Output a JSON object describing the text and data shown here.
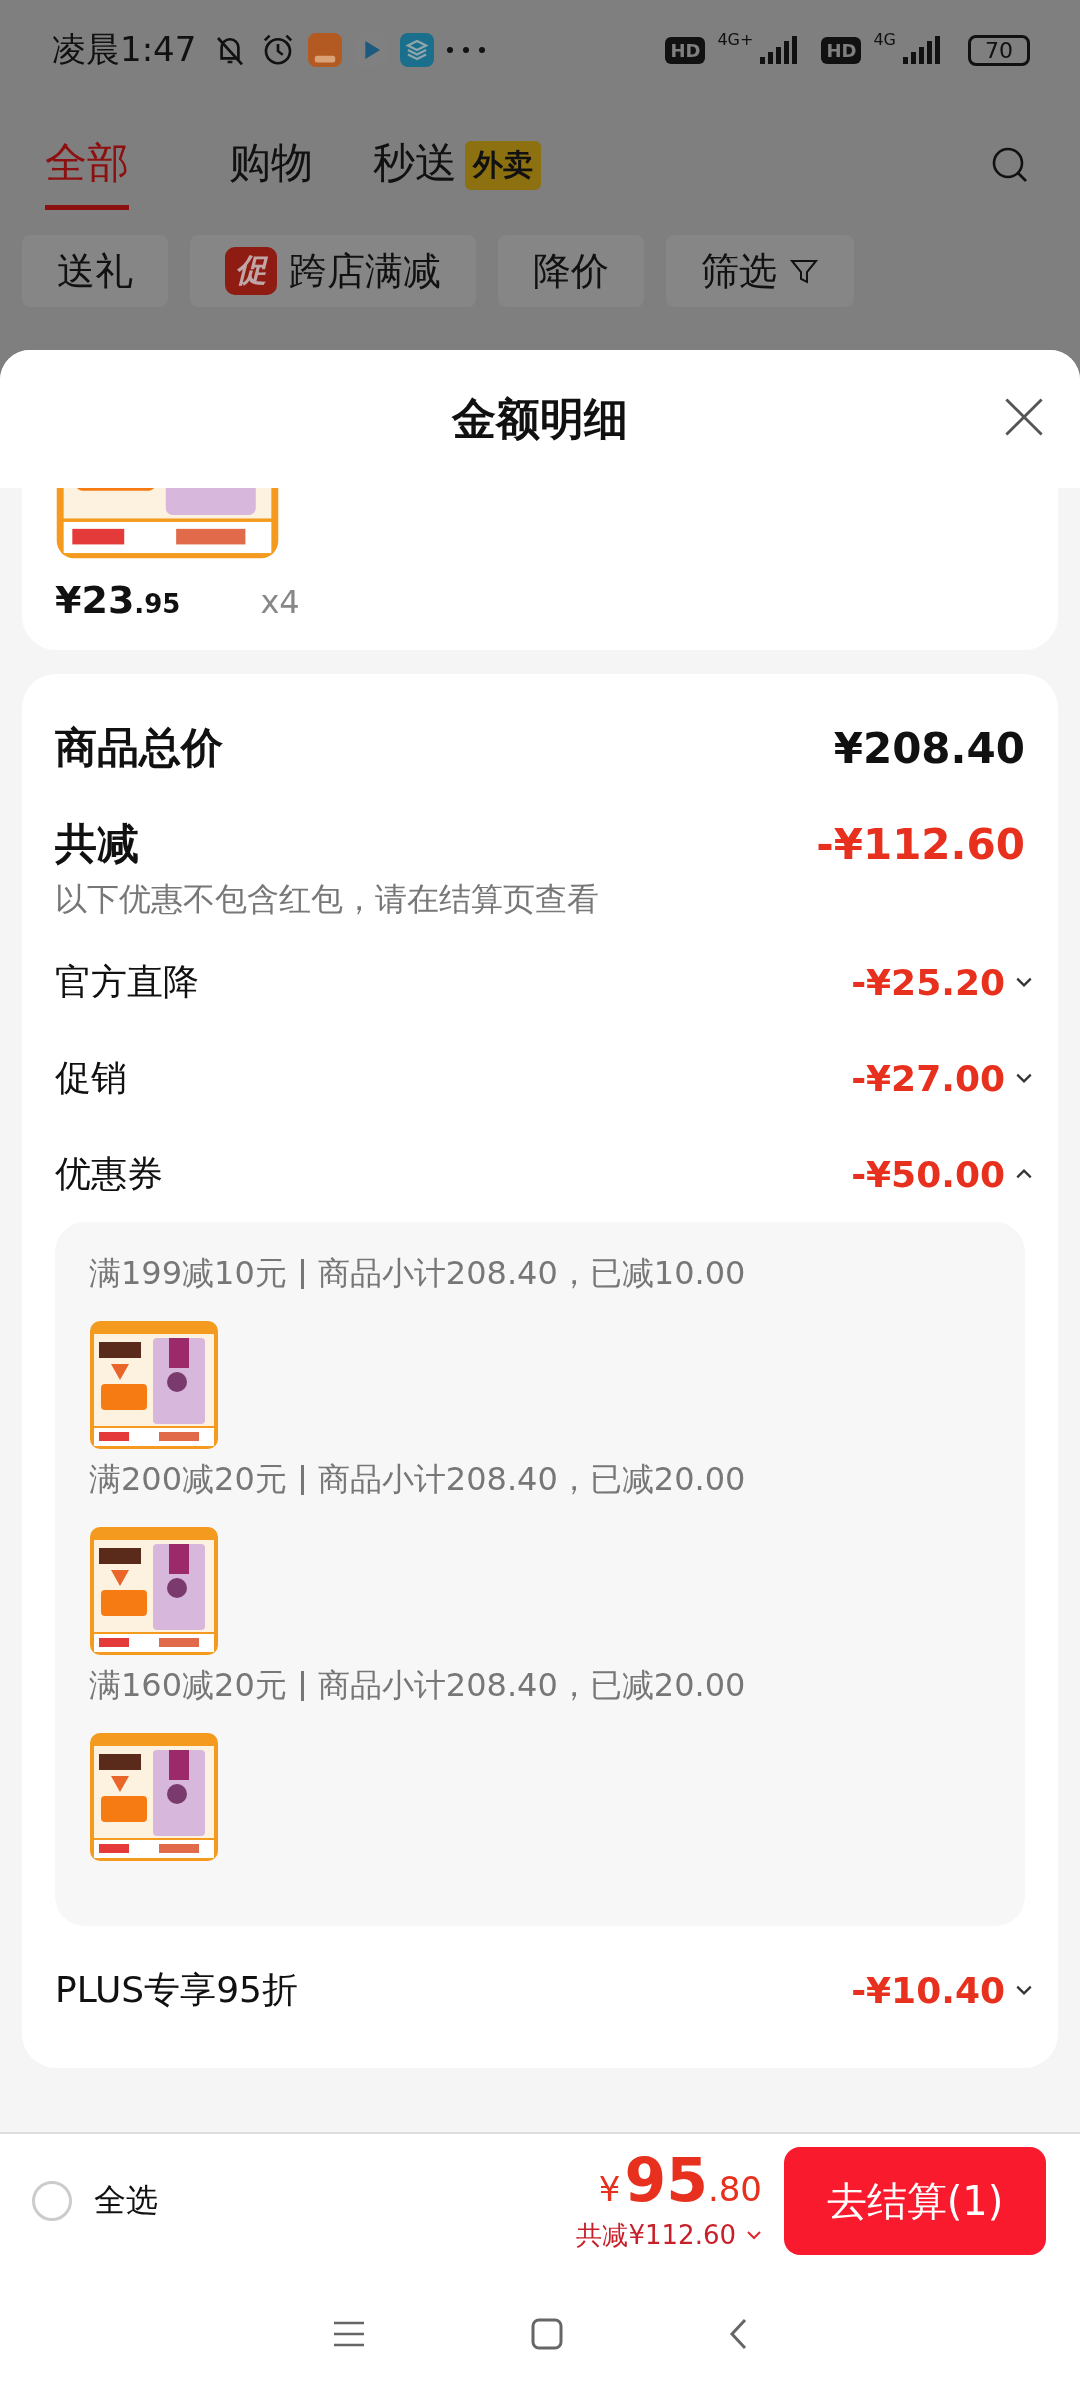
{
  "status_bar": {
    "time": "凌晨1:47",
    "networks": [
      {
        "hd": "HD",
        "type": "4G+"
      },
      {
        "hd": "HD",
        "type": "4G"
      }
    ],
    "battery": "70"
  },
  "tabs": [
    {
      "label": "全部",
      "selected": true
    },
    {
      "label": "购物",
      "selected": false
    },
    {
      "label": "秒送",
      "selected": false,
      "badge": "外卖"
    }
  ],
  "filter_chips": [
    {
      "kind": "plain",
      "label": "送礼"
    },
    {
      "kind": "promo",
      "badge": "促",
      "label": "跨店满减"
    },
    {
      "kind": "plain",
      "label": "降价"
    },
    {
      "kind": "filter",
      "label": "筛选"
    }
  ],
  "sheet": {
    "title": "金额明细"
  },
  "product": {
    "kind": "picture",
    "price": "¥23",
    "price_decimal": ".95",
    "quantity": "x4"
  },
  "summary": {
    "total": {
      "label": "商品总价",
      "value": "¥208.40"
    },
    "reduction": {
      "label": "共减",
      "value": "-¥112.60",
      "note": "以下优惠不包含红包，请在结算页查看"
    },
    "discounts": [
      {
        "label": "官方直降",
        "value": "-¥25.20",
        "expanded": false
      },
      {
        "label": "促销",
        "value": "-¥27.00",
        "expanded": false
      },
      {
        "label": "优惠券",
        "value": "-¥50.00",
        "expanded": true,
        "coupons": [
          {
            "rule": "满199减10元",
            "detail": "商品小计208.40，已减10.00"
          },
          {
            "rule": "满200减20元",
            "detail": "商品小计208.40，已减20.00"
          },
          {
            "rule": "满160减20元",
            "detail": "商品小计208.40，已减20.00"
          }
        ]
      },
      {
        "label": "PLUS专享95折",
        "value": "-¥10.40",
        "expanded": false
      }
    ]
  },
  "bottom_bar": {
    "select_all": {
      "label": "全选",
      "checked": false
    },
    "currency": "¥",
    "total": "95",
    "total_decimal": ".80",
    "reduction": "共减¥112.60",
    "checkout": "去结算(1)"
  }
}
